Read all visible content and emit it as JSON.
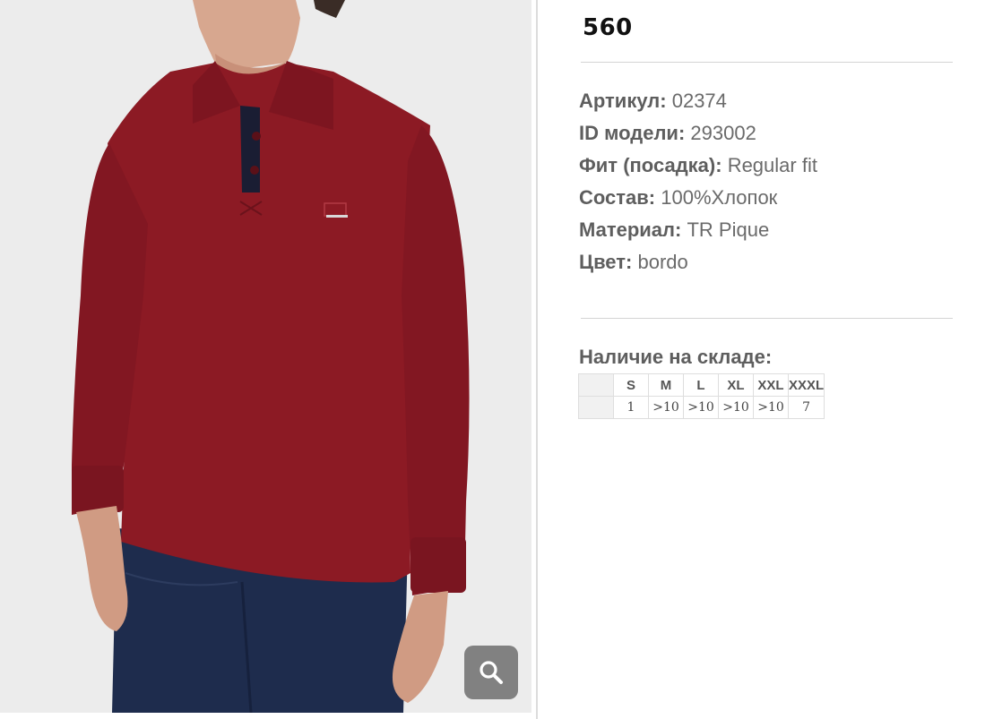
{
  "product": {
    "price": "560",
    "specs": [
      {
        "label": "Артикул:",
        "value": "02374"
      },
      {
        "label": "ID модели:",
        "value": "293002"
      },
      {
        "label": "Фит (посадка):",
        "value": "Regular fit"
      },
      {
        "label": "Состав:",
        "value": "100%Хлопок"
      },
      {
        "label": "Материал:",
        "value": "TR Pique"
      },
      {
        "label": "Цвет:",
        "value": "bordo"
      }
    ]
  },
  "stock": {
    "title": "Наличие на складе:",
    "sizes": [
      "S",
      "M",
      "L",
      "XL",
      "XXL",
      "XXXL"
    ],
    "quantities": [
      "1",
      ">10",
      ">10",
      ">10",
      ">10",
      "7"
    ]
  },
  "image": {
    "zoom_icon": "search-icon",
    "shirt_color": "#8c1a24",
    "background_color": "#ececec"
  }
}
